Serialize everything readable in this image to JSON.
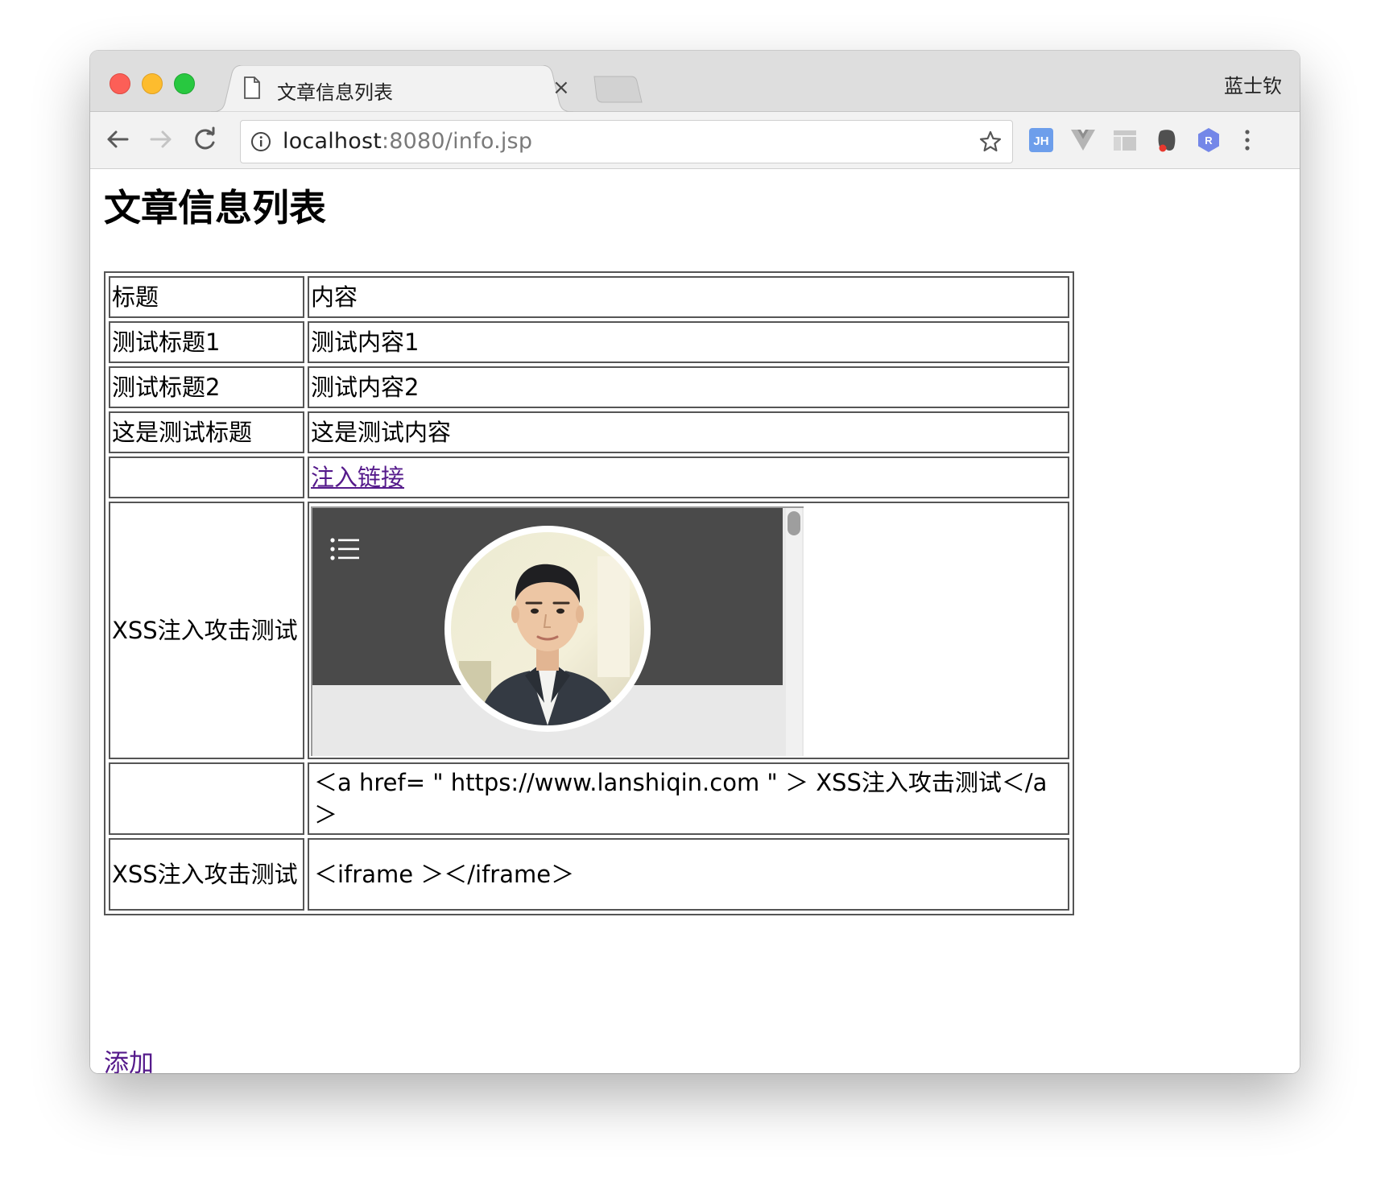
{
  "browser": {
    "tab_title": "文章信息列表",
    "tab_close": "×",
    "profile_name": "蓝士钦",
    "url_host": "localhost",
    "url_rest": ":8080/info.jsp",
    "extensions": [
      "jh-icon",
      "vue-devtools-icon",
      "layout-icon",
      "evernote-icon",
      "redux-icon"
    ]
  },
  "page": {
    "title": "文章信息列表",
    "add_label": "添加"
  },
  "table": {
    "header": {
      "title": "标题",
      "content": "内容"
    },
    "rows": [
      {
        "title": "测试标题1",
        "content": "测试内容1"
      },
      {
        "title": "测试标题2",
        "content": "测试内容2"
      },
      {
        "title": "这是测试标题",
        "content": "这是测试内容"
      },
      {
        "title": "",
        "content": "注入链接"
      },
      {
        "title": "XSS注入攻击测试",
        "content": ""
      },
      {
        "title": "",
        "content": "＜a href= \" https://www.lanshiqin.com \" ＞ XSS注入攻击测试＜/a＞"
      },
      {
        "title": "XSS注入攻击测试",
        "content": "＜iframe ＞＜/iframe＞"
      }
    ]
  },
  "colors": {
    "visited_link": "#551a8b",
    "iframe_header": "#4a4a4a",
    "iframe_body": "#e8e8e8"
  }
}
